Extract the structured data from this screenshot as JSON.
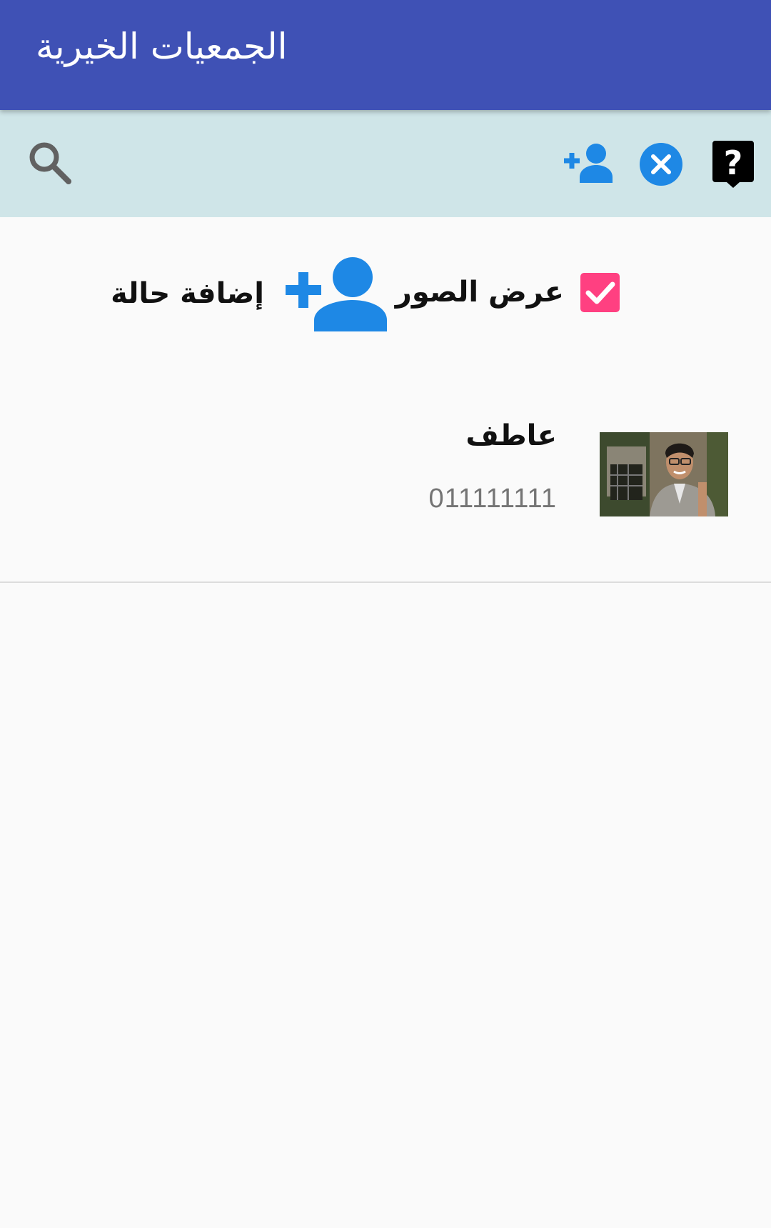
{
  "appbar": {
    "title": "الجمعيات الخيرية",
    "color": "#3f51b5"
  },
  "toolbar": {
    "background": "#cfe5e8",
    "icons": [
      "help-icon",
      "cancel-icon",
      "add-person-icon",
      "search-icon"
    ],
    "accent": "#1e88e5"
  },
  "controls": {
    "show_images_label": "عرض الصور",
    "show_images_checked": true,
    "checkbox_color": "#ff4081",
    "add_case_label": "إضافة حالة"
  },
  "cases": [
    {
      "name": "عاطف",
      "phone": "011111111"
    }
  ]
}
